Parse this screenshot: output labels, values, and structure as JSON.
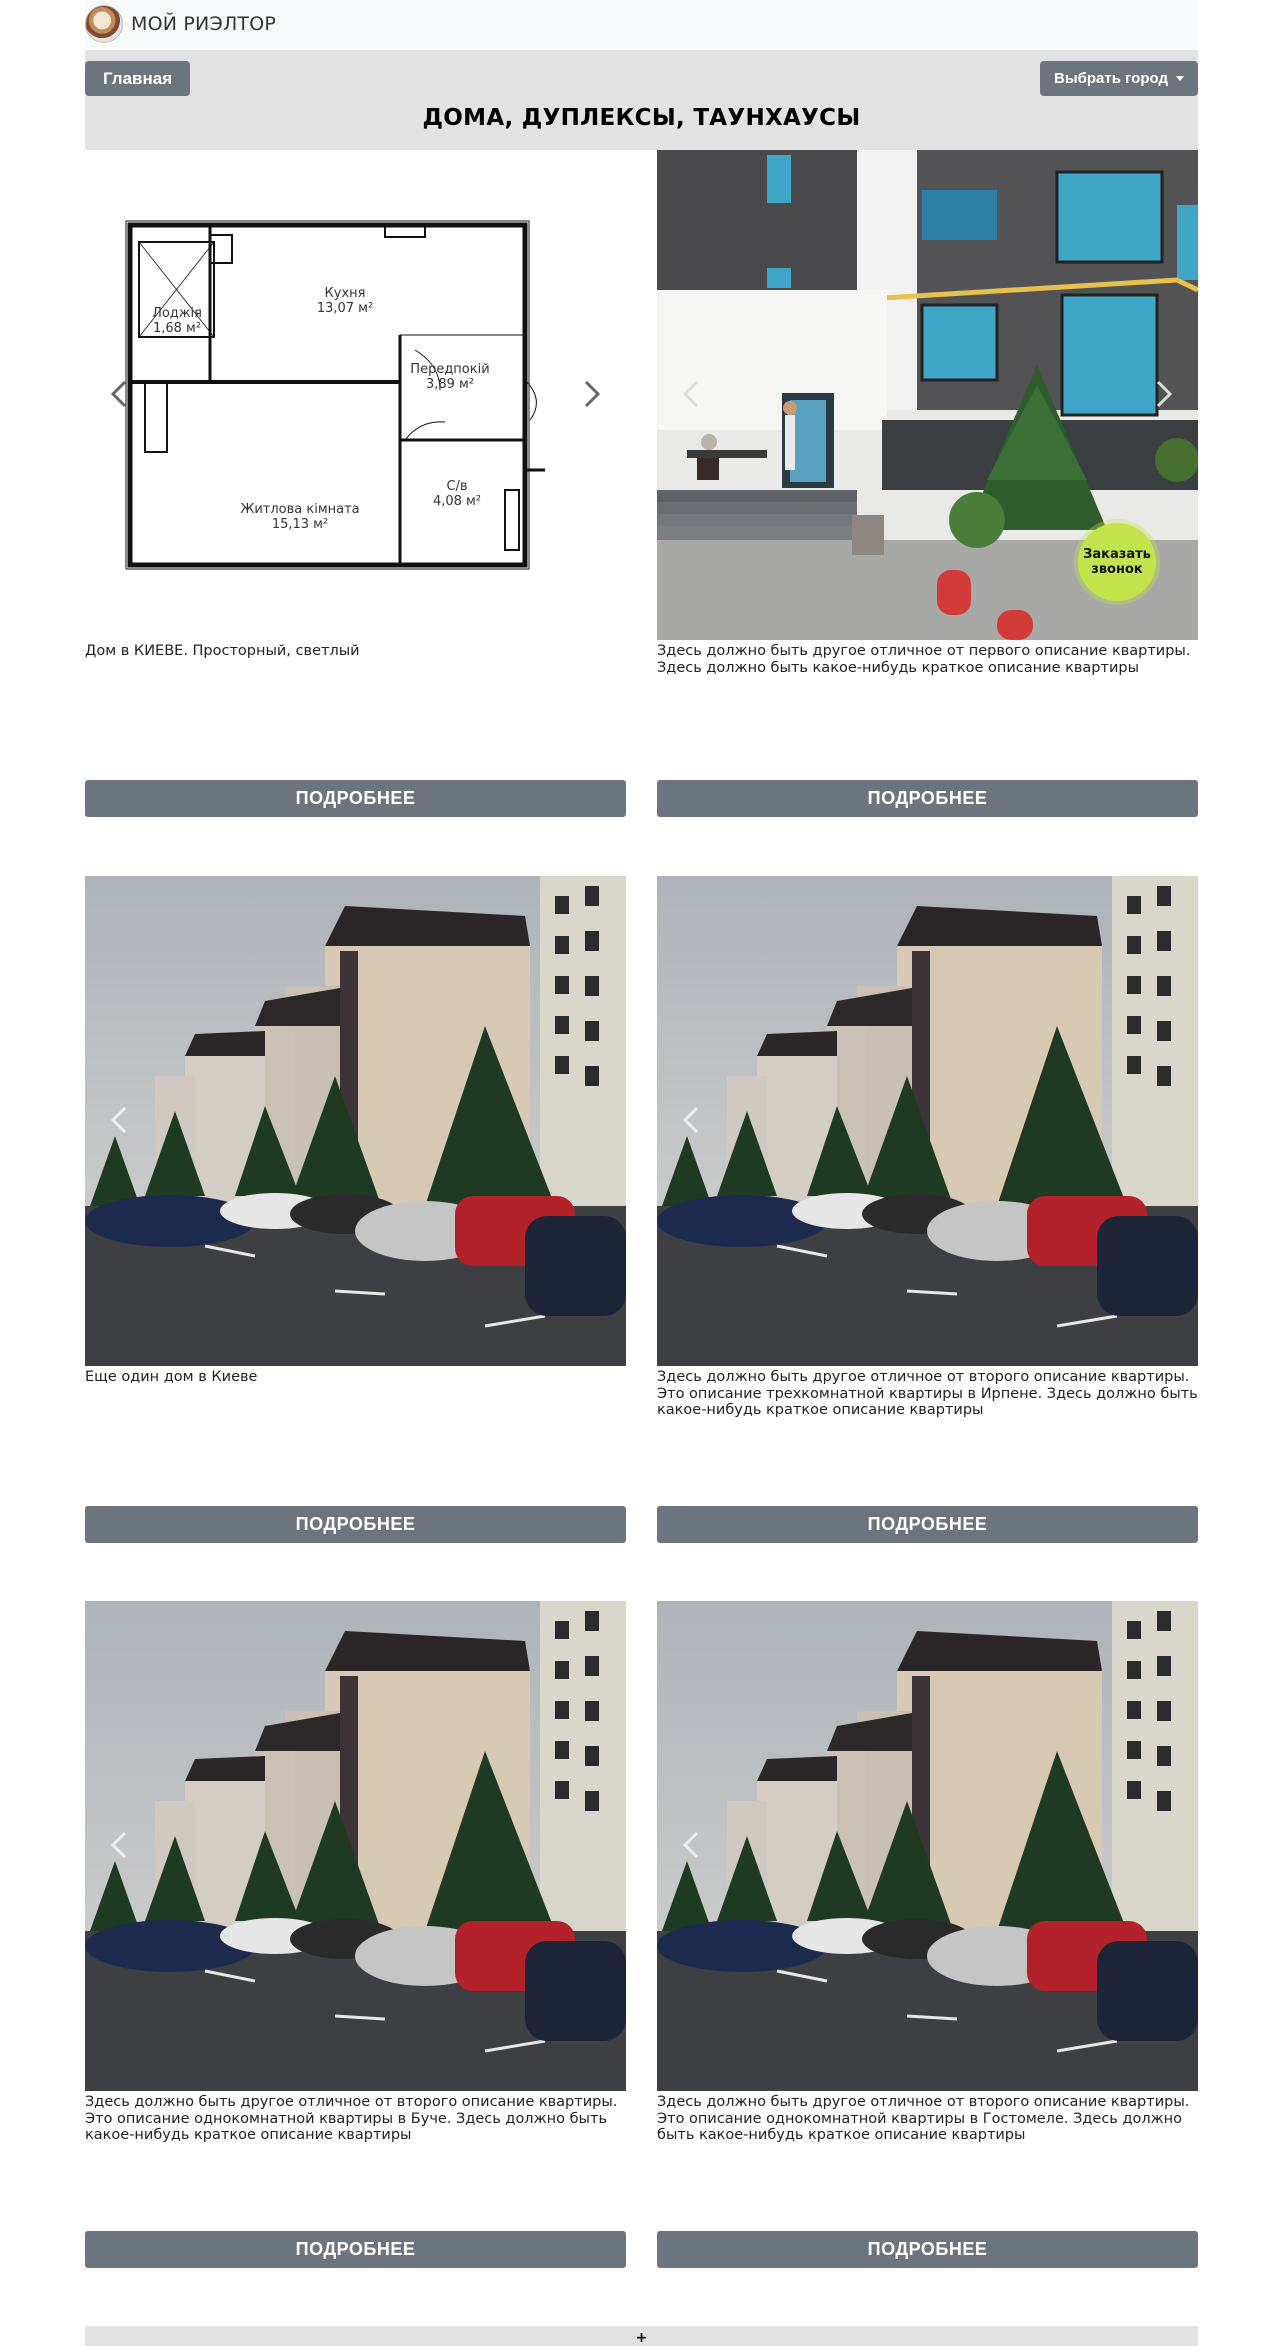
{
  "navbar": {
    "brand": "МОЙ РИЭЛТОР",
    "logo_icon": "realtor-logo-icon"
  },
  "header": {
    "home_button": "Главная",
    "city_button": "Выбрать город",
    "title": "ДОМА, ДУПЛЕКСЫ, ТАУНХАУСЫ"
  },
  "floorplan": {
    "rooms": [
      {
        "name": "Кухня",
        "area": "13,07 м²"
      },
      {
        "name": "Лоджія",
        "area": "1,68 м²"
      },
      {
        "name": "Передпокій",
        "area": "3,89 м²"
      },
      {
        "name": "Житлова кімната",
        "area": "15,13 м²"
      },
      {
        "name": "С/в",
        "area": "4,08 м²"
      }
    ]
  },
  "cards": [
    {
      "image": "floorplan",
      "description": "Дом в КИЕВЕ. Просторный, светлый",
      "button": "ПОДРОБНЕЕ"
    },
    {
      "image": "building-entrance",
      "description": "Здесь должно быть другое отличное от первого описание квартиры. Здесь должно быть какое-нибудь краткое описание квартиры",
      "button": "ПОДРОБНЕЕ"
    },
    {
      "image": "residential-complex-parking",
      "description": "Еще один дом в Киеве",
      "button": "ПОДРОБНЕЕ"
    },
    {
      "image": "residential-complex-parking",
      "description": "Здесь должно быть другое отличное от второго описание квартиры. Это описание трехкомнатной квартиры в Ирпене. Здесь должно быть какое-нибудь краткое описание квартиры",
      "button": "ПОДРОБНЕЕ"
    },
    {
      "image": "residential-complex-parking",
      "description": "Здесь должно быть другое отличное от второго описание квартиры. Это описание однокомнатной квартиры в Буче. Здесь должно быть какое-нибудь краткое описание квартиры",
      "button": "ПОДРОБНЕЕ"
    },
    {
      "image": "residential-complex-parking",
      "description": "Здесь должно быть другое отличное от второго описание квартиры. Это описание однокомнатной квартиры в Гостомеле. Здесь должно быть какое-нибудь краткое описание квартиры",
      "button": "ПОДРОБНЕЕ"
    }
  ],
  "callback_widget": {
    "label_line1": "Заказать",
    "label_line2": "звонок",
    "color": "#c3e34c"
  },
  "footer": {
    "expand_label": "+"
  },
  "colors": {
    "button_bg": "#6c757d",
    "header_bg": "#e2e2e2",
    "navbar_bg": "#f8f9fa"
  }
}
